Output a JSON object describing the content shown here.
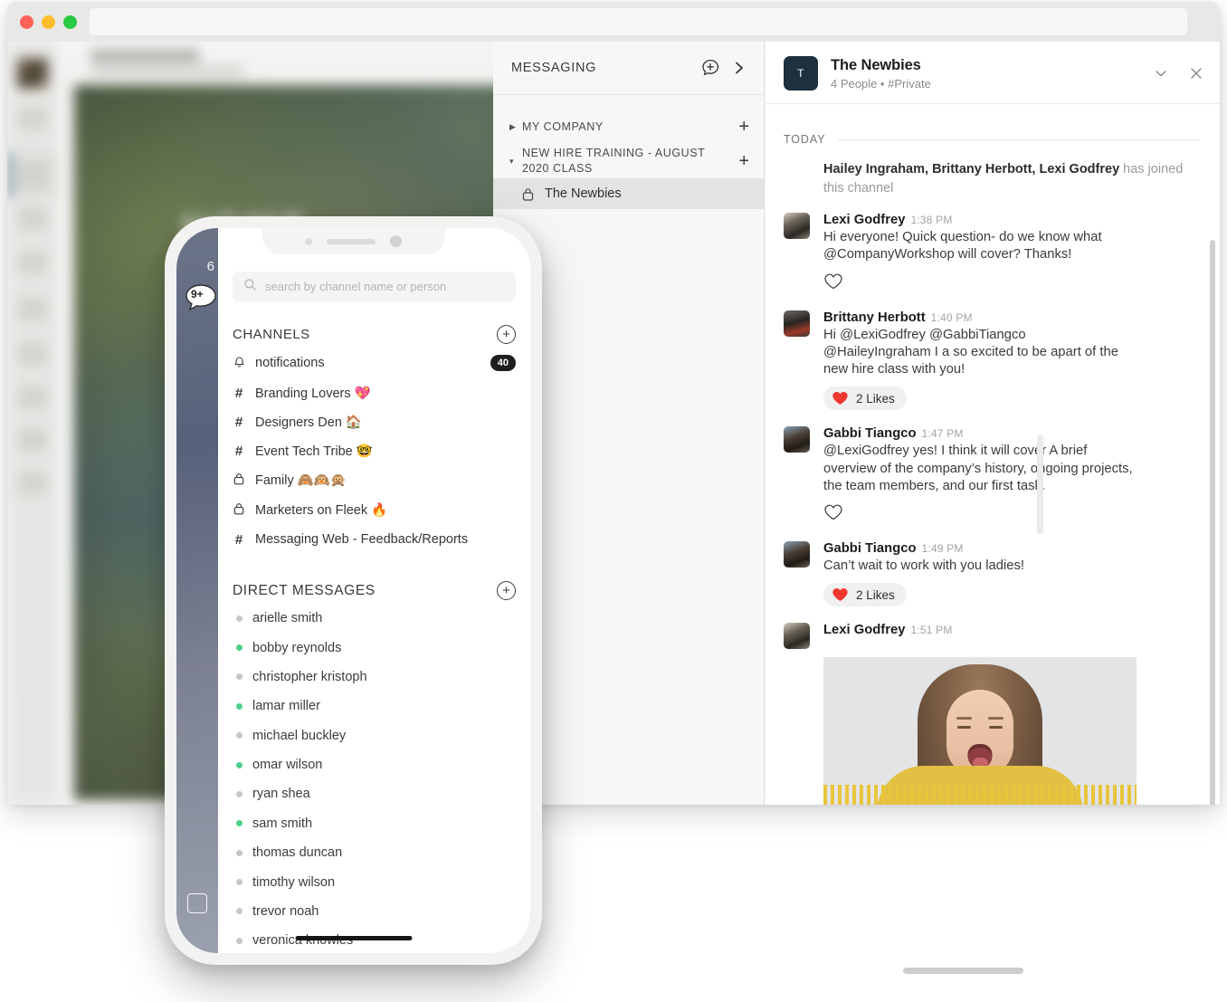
{
  "window": {
    "traffic_lights": [
      "close",
      "minimize",
      "maximize"
    ],
    "url_value": ""
  },
  "background_app": {
    "hero_label": "HOME"
  },
  "messaging_panel": {
    "header": {
      "title": "MESSAGING",
      "new_message_icon": "new-message-icon",
      "expand_icon": "chevron-right-icon"
    },
    "groups": [
      {
        "label": "MY COMPANY",
        "expanded": false,
        "caret": "▶",
        "add_label": "+",
        "channels": []
      },
      {
        "label": "NEW HIRE TRAINING - AUGUST 2020 CLASS",
        "expanded": true,
        "caret": "▾",
        "add_label": "+",
        "channels": [
          {
            "name": "The Newbies",
            "private": true,
            "active": true
          }
        ]
      }
    ]
  },
  "chat": {
    "header": {
      "avatar_initial": "T",
      "title": "The Newbies",
      "subtitle": "4 People  •  #Private",
      "collapse_icon": "chevron-down-icon",
      "close_icon": "close-icon"
    },
    "date_divider": "TODAY",
    "system_message": {
      "names": "Hailey Ingraham, Brittany Herbott, Lexi Godfrey",
      "action": " has joined this channel"
    },
    "messages": [
      {
        "author": "Lexi Godfrey",
        "time": "1:38 PM",
        "text": "Hi everyone! Quick question- do we know what @CompanyWorkshop will cover? Thanks!",
        "reaction": {
          "type": "outline",
          "label": ""
        },
        "avatar": "av-lexi"
      },
      {
        "author": "Brittany Herbott",
        "time": "1:40 PM",
        "text": "Hi @LexiGodfrey @GabbiTiangco @HaileyIngraham I a so excited to be apart of the new hire class with you!",
        "reaction": {
          "type": "pill",
          "label": "2 Likes"
        },
        "avatar": "av-brit"
      },
      {
        "author": "Gabbi Tiangco",
        "time": "1:47 PM",
        "text": " @LexiGodfrey yes! I think it will cover A brief overview of the company’s history, ongoing projects, the team members, and our first task.",
        "reaction": {
          "type": "outline",
          "label": ""
        },
        "avatar": "av-gabbi"
      },
      {
        "author": "Gabbi Tiangco",
        "time": "1:49 PM",
        "text": "Can’t wait to work with you ladies!",
        "reaction": {
          "type": "pill",
          "label": "2 Likes"
        },
        "avatar": "av-gabbi"
      },
      {
        "author": "Lexi Godfrey",
        "time": "1:51 PM",
        "text": "",
        "attachment": "gif-image",
        "reaction": null,
        "avatar": "av-lexi"
      }
    ]
  },
  "phone": {
    "peek": {
      "unread_badge": "9+",
      "corner_number": "6"
    },
    "search": {
      "placeholder": "search by channel name or person",
      "icon": "search-icon"
    },
    "channels_section": {
      "title": "CHANNELS",
      "add_icon": "plus-circle-icon",
      "items": [
        {
          "symbol": "bell",
          "name": "notifications",
          "badge": "40"
        },
        {
          "symbol": "#",
          "name": "Branding Lovers 💖",
          "badge": ""
        },
        {
          "symbol": "#",
          "name": "Designers Den 🏠",
          "badge": ""
        },
        {
          "symbol": "#",
          "name": "Event Tech Tribe 🤓",
          "badge": ""
        },
        {
          "symbol": "lock",
          "name": "Family 🙈🙉🙊",
          "badge": ""
        },
        {
          "symbol": "lock",
          "name": "Marketers on Fleek 🔥",
          "badge": ""
        },
        {
          "symbol": "#",
          "name": "Messaging Web - Feedback/Reports",
          "badge": ""
        }
      ]
    },
    "direct_messages_section": {
      "title": "DIRECT MESSAGES",
      "add_icon": "plus-circle-icon",
      "items": [
        {
          "name": "arielle smith",
          "online": false
        },
        {
          "name": "bobby reynolds",
          "online": true
        },
        {
          "name": "christopher kristoph",
          "online": false
        },
        {
          "name": "lamar miller",
          "online": true
        },
        {
          "name": "michael buckley",
          "online": false
        },
        {
          "name": "omar wilson",
          "online": true
        },
        {
          "name": "ryan shea",
          "online": false
        },
        {
          "name": "sam smith",
          "online": true
        },
        {
          "name": "thomas duncan",
          "online": false
        },
        {
          "name": "timothy wilson",
          "online": false
        },
        {
          "name": "trevor noah",
          "online": false
        },
        {
          "name": "veronica knowles",
          "online": false
        }
      ]
    }
  },
  "colors": {
    "online_green": "#4fcf8c",
    "offline_gray": "#c7c7c5",
    "heart_red": "#f0372f",
    "avatar_navy": "#1d3040",
    "badge_dark": "#1e1e1e"
  }
}
